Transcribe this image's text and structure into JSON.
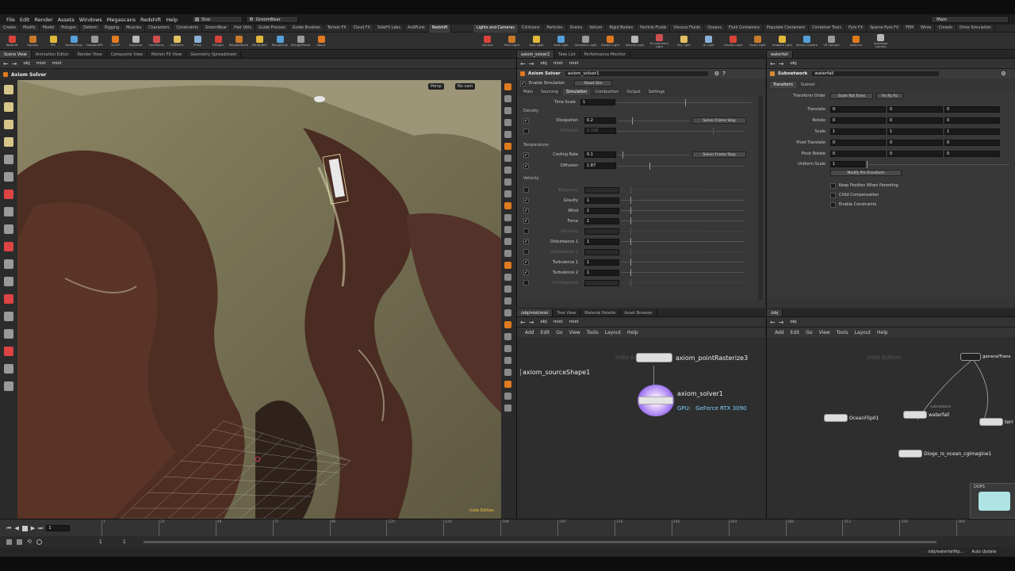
{
  "menu": [
    "File",
    "Edit",
    "Render",
    "Assets",
    "Windows",
    "Megascans",
    "Redshift",
    "Help"
  ],
  "desktop": "Duo",
  "workspace": "GroomBear",
  "update": "Main",
  "shelf_tabs_left": [
    "Create",
    "Modify",
    "Model",
    "Polygon",
    "Deform",
    "Rigging",
    "Muscles",
    "Characters",
    "Constraints",
    "GroomBear",
    "Hair Utils",
    "Guide Process",
    "Guide Brushes",
    "Terrain FX",
    "Cloud FX",
    "SideFX Labs",
    "AxSPLink",
    "Redshift"
  ],
  "shelf_tabs_right": [
    "Lights and Cameras",
    "Collisions",
    "Particles",
    "Grains",
    "Vellum",
    "Rigid Bodies",
    "Particle Fluids",
    "Viscous Fluids",
    "Oceans",
    "Fluid Containers",
    "Populate Containers",
    "Container Tools",
    "Pyro FX",
    "Sparse Pyro FX",
    "FEM",
    "Wires",
    "Crowds",
    "Drive Simulation"
  ],
  "shelf_tools_left": [
    "Redshift",
    "Options",
    "IPR",
    "RenderView",
    "ViewportIPR",
    "On/Off",
    "Snapshot",
    "CamParms",
    "ObjParms",
    "Proxy",
    "RSLight",
    "RSLightDome",
    "RSLightIES",
    "RSLightSun",
    "RSLightPortal",
    "About"
  ],
  "shelf_tools_right": [
    "Camera",
    "Point Light",
    "Spot Light",
    "Area Light",
    "Geometry Light",
    "Distant Light",
    "Volume Light",
    "Environment Light",
    "Sky Light",
    "GI Light",
    "Caustic Light",
    "Portal Light",
    "Ambient Light",
    "Stereo Camera",
    "VR Camera",
    "Switcher",
    "Gamepad Camera"
  ],
  "viewer": {
    "tabs": [
      "Scene View",
      "Animation Editor",
      "Render View",
      "Composite View",
      "Motion FX View",
      "Geometry Spreadsheet"
    ],
    "path": [
      "obj",
      "mist",
      "mist"
    ],
    "title": "Axiom Solver",
    "persp": "Persp",
    "cam": "No cam",
    "edition": "Indie Edition"
  },
  "params": {
    "tabs": [
      "axiom_solver2",
      "Take List",
      "Performance Monitor"
    ],
    "path": [
      "obj",
      "mist",
      "mist"
    ],
    "node_type": "Axiom Solver",
    "node_name": "axiom_solver1",
    "enable_sim": "Enable Simulation",
    "reset_sim": "Reset Sim",
    "subtabs": [
      "Main",
      "Sourcing",
      "Simulation",
      "Combustion",
      "Output",
      "Settings"
    ],
    "time_scale_label": "Time Scale",
    "time_scale": "1",
    "density": "Density",
    "dissipation_label": "Dissipation",
    "dissipation": "0.2",
    "solver_frame_step": "Solver Frame Step",
    "diffusion_label": "Diffusion",
    "density_diffusion": "0.338",
    "temperature": "Temperature",
    "cooling_label": "Cooling Rate",
    "cooling": "0.1",
    "temp_diffusion": "1.87",
    "velocity": "Velocity",
    "vel_rows": [
      {
        "label": "Buoyancy",
        "value": "",
        "enabled": false
      },
      {
        "label": "Gravity",
        "value": "1",
        "enabled": true
      },
      {
        "label": "Wind",
        "value": "1",
        "enabled": true
      },
      {
        "label": "Force",
        "value": "1",
        "enabled": true
      },
      {
        "label": "Viscosity",
        "value": "",
        "enabled": false
      },
      {
        "label": "Disturbance 1",
        "value": "1",
        "enabled": true
      },
      {
        "label": "Disturbance 2",
        "value": "",
        "enabled": false
      },
      {
        "label": "Turbulence 1",
        "value": "1",
        "enabled": true
      },
      {
        "label": "Turbulence 2",
        "value": "1",
        "enabled": true
      },
      {
        "label": "Confinement",
        "value": "",
        "enabled": false
      }
    ]
  },
  "subnet": {
    "tabs": [
      "waterfall"
    ],
    "path": [
      "obj"
    ],
    "node_type": "Subnetwork",
    "node_name": "waterfall",
    "subtabs": [
      "Transform",
      "Subnet"
    ],
    "transform_order_label": "Transform Order",
    "transform_order": "Scale Rot Trans",
    "rot_order": "Rx Ry Rz",
    "rows": [
      {
        "label": "Translate",
        "v": [
          "0",
          "0",
          "0"
        ]
      },
      {
        "label": "Rotate",
        "v": [
          "0",
          "0",
          "0"
        ]
      },
      {
        "label": "Scale",
        "v": [
          "1",
          "1",
          "1"
        ]
      },
      {
        "label": "Pivot Translate",
        "v": [
          "0",
          "0",
          "0"
        ]
      },
      {
        "label": "Pivot Rotate",
        "v": [
          "0",
          "0",
          "0"
        ]
      }
    ],
    "uniform_scale_label": "Uniform Scale",
    "uniform_scale": "1",
    "modify_btn": "Modify Pre-Transform",
    "checks": [
      "Keep Position When Parenting",
      "Child Compensation",
      "Enable Constraints"
    ]
  },
  "netleft": {
    "tabs": [
      "/obj/mist/mist",
      "Tree View",
      "Material Palette",
      "Asset Browser"
    ],
    "path": [
      "obj",
      "mist",
      "mist"
    ],
    "menu": [
      "Add",
      "Edit",
      "Go",
      "View",
      "Tools",
      "Layout",
      "Help"
    ],
    "edition": "Indie Edition",
    "nodes": {
      "rasterize": "axiom_pointRasterize3",
      "source": "axiom_sourceShape1",
      "solver": "axiom_solver1",
      "gpu_prefix": "GPU:",
      "gpu": "GeForce RTX 3090"
    }
  },
  "netright": {
    "tabs": [
      "/obj"
    ],
    "path": [
      "obj"
    ],
    "menu": [
      "Add",
      "Edit",
      "Go",
      "View",
      "Tools",
      "Layout",
      "Help"
    ],
    "edition": "Indie Edition",
    "nodes": {
      "general": "generalTrans",
      "subnet_tag": "subnetwork",
      "ocean": "OceanFlip01",
      "waterfall": "waterfall",
      "ter": "terr",
      "diogo": "Diogo_rs_ocean_cgimagine1",
      "dops": "DOPS"
    }
  },
  "timeline": {
    "frame": "1",
    "ticks": [
      "1",
      "24",
      "48",
      "72",
      "96",
      "120",
      "144",
      "168",
      "192",
      "216",
      "240",
      "264",
      "288",
      "312",
      "336",
      "360"
    ],
    "start": "1",
    "end": "1",
    "status_path": "/obj/waterfallflip...",
    "auto_update": "Auto Update"
  }
}
